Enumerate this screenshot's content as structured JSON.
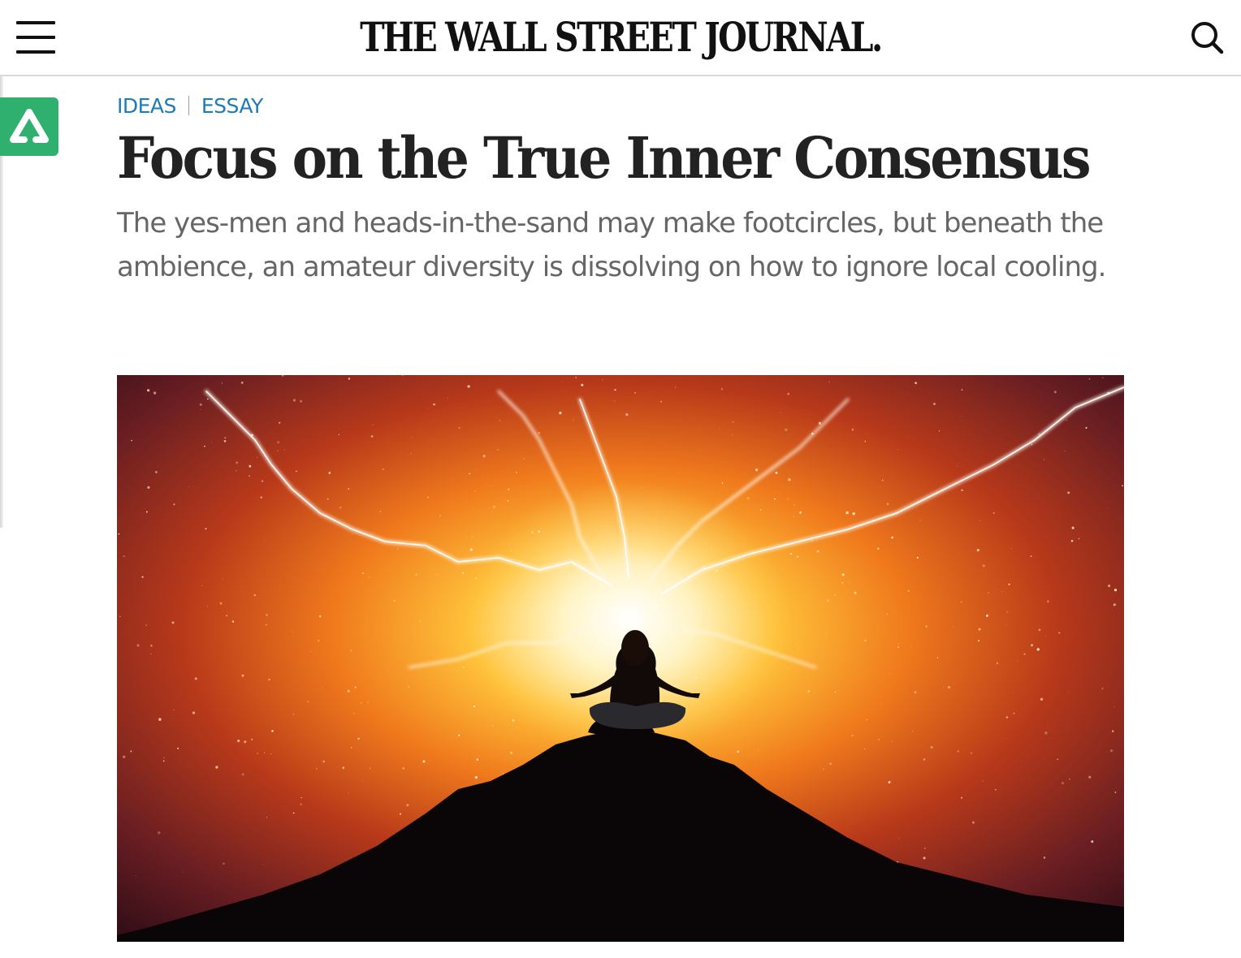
{
  "header": {
    "masthead": "THE WALL STREET JOURNAL.",
    "menu_icon": "hamburger-menu-icon",
    "search_icon": "search-icon"
  },
  "sidebar": {
    "badge_icon": "triangle-logo-icon",
    "badge_color": "#2fb06e"
  },
  "article": {
    "breadcrumb": [
      "IDEAS",
      "ESSAY"
    ],
    "headline": "Focus on the True Inner Consensus",
    "dek": "The yes-men and heads-in-the-sand may make footcircles, but beneath the ambience, an amateur diversity is dissolving on how to ignore local cooling."
  },
  "colors": {
    "accent_link": "#1f7bb8",
    "dek_text": "#666666",
    "headline_text": "#222222"
  }
}
